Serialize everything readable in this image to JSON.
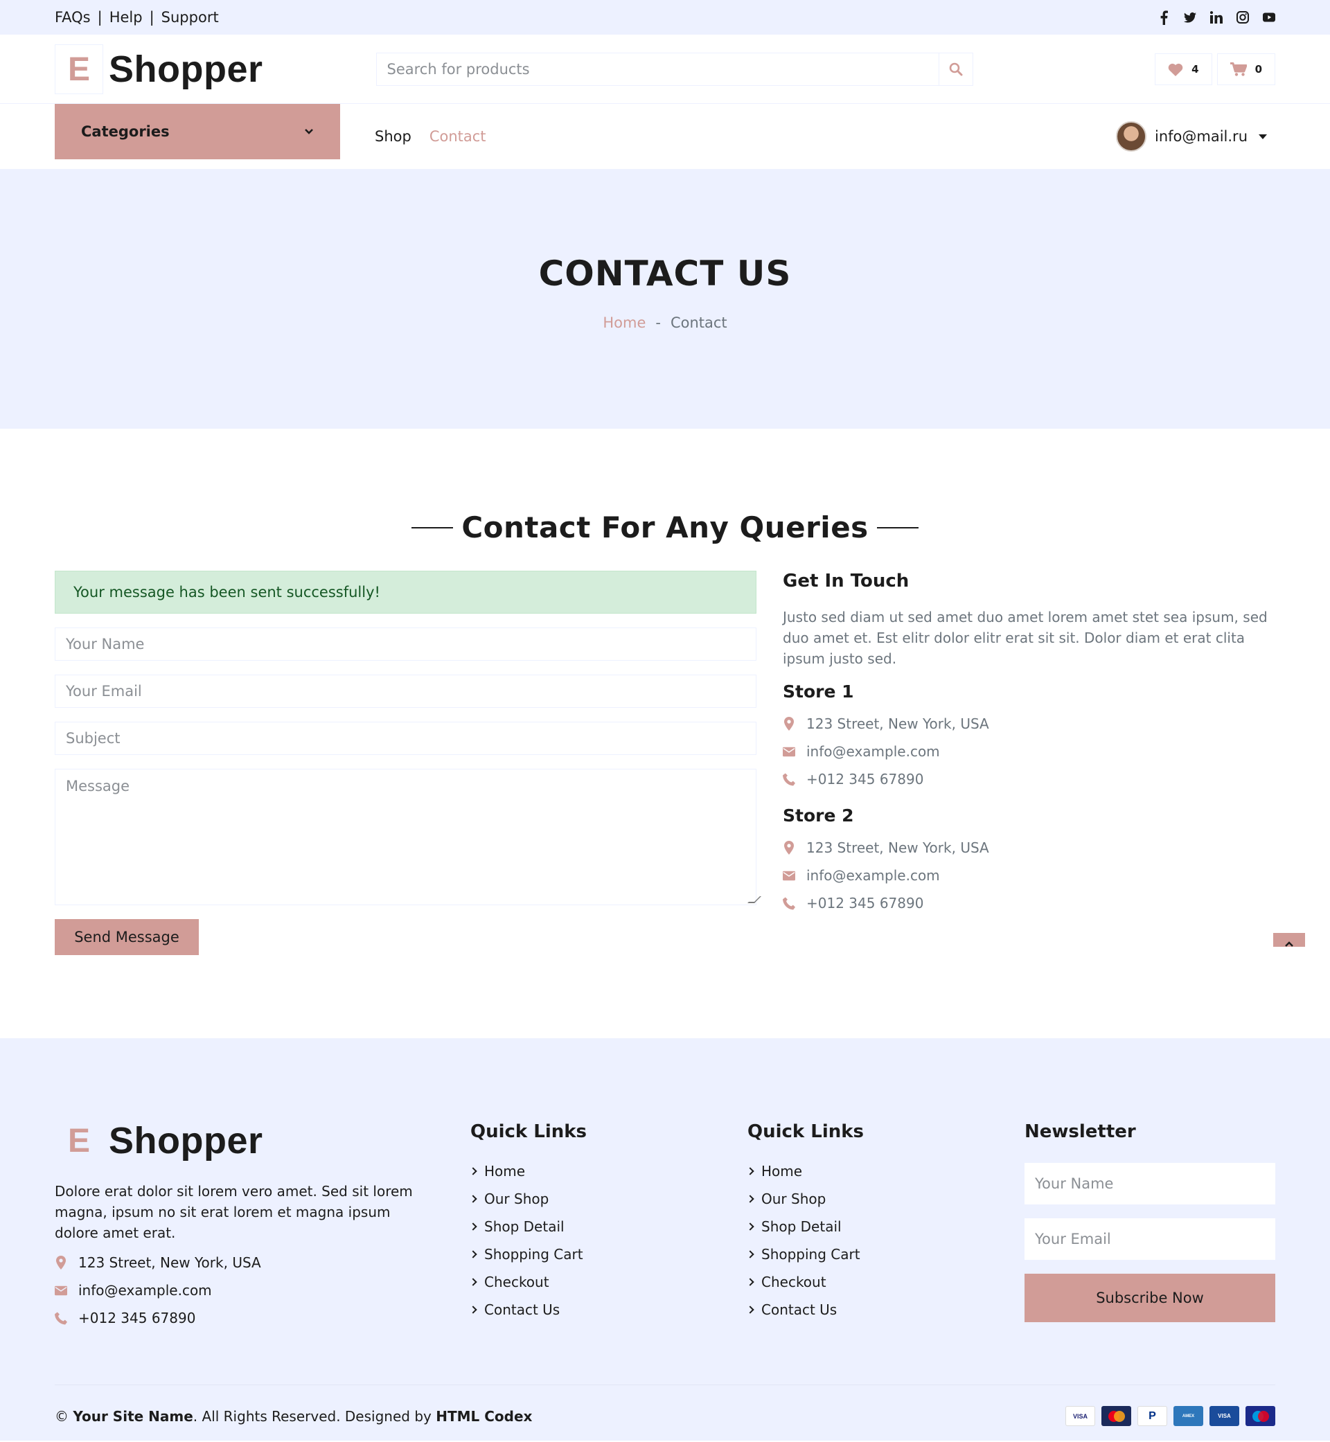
{
  "topbar": {
    "links": [
      "FAQs",
      "Help",
      "Support"
    ],
    "separator": "|"
  },
  "socials": [
    "facebook-icon",
    "twitter-icon",
    "linkedin-icon",
    "instagram-icon",
    "youtube-icon"
  ],
  "brand": {
    "letter": "E",
    "name": "Shopper"
  },
  "search": {
    "placeholder": "Search for products"
  },
  "header": {
    "wishlist_count": "4",
    "cart_count": "0"
  },
  "nav": {
    "categories_label": "Categories",
    "links": [
      "Shop",
      "Contact"
    ],
    "user_email": "info@mail.ru"
  },
  "page_header": {
    "title": "CONTACT US",
    "breadcrumb_home": "Home",
    "breadcrumb_sep": "-",
    "breadcrumb_current": "Contact"
  },
  "contact": {
    "section_title": "Contact For Any Queries",
    "alert": "Your message has been sent successfully!",
    "placeholders": {
      "name": "Your Name",
      "email": "Your Email",
      "subject": "Subject",
      "message": "Message"
    },
    "send_label": "Send Message",
    "get_in_touch": "Get In Touch",
    "description": "Justo sed diam ut sed amet duo amet lorem amet stet sea ipsum, sed duo amet et. Est elitr dolor elitr erat sit sit. Dolor diam et erat clita ipsum justo sed.",
    "stores": [
      {
        "name": "Store 1",
        "address": "123 Street, New York, USA",
        "email": "info@example.com",
        "phone": "+012 345 67890"
      },
      {
        "name": "Store 2",
        "address": "123 Street, New York, USA",
        "email": "info@example.com",
        "phone": "+012 345 67890"
      }
    ]
  },
  "footer": {
    "about": "Dolore erat dolor sit lorem vero amet. Sed sit lorem magna, ipsum no sit erat lorem et magna ipsum dolore amet erat.",
    "address": "123 Street, New York, USA",
    "email": "info@example.com",
    "phone": "+012 345 67890",
    "columns": [
      {
        "title": "Quick Links",
        "links": [
          "Home",
          "Our Shop",
          "Shop Detail",
          "Shopping Cart",
          "Checkout",
          "Contact Us"
        ]
      },
      {
        "title": "Quick Links",
        "links": [
          "Home",
          "Our Shop",
          "Shop Detail",
          "Shopping Cart",
          "Checkout",
          "Contact Us"
        ]
      }
    ],
    "newsletter": {
      "title": "Newsletter",
      "name_placeholder": "Your Name",
      "email_placeholder": "Your Email",
      "button": "Subscribe Now"
    },
    "copyright": {
      "symbol": "©",
      "site": "Your Site Name",
      "text": ". All Rights Reserved. Designed by ",
      "designer": "HTML Codex"
    },
    "payments": [
      "VISA",
      "MasterCard",
      "PayPal",
      "AMERICAN EXPRESS",
      "VISA Electron",
      "Maestro"
    ]
  },
  "colors": {
    "accent": "#d19c97",
    "light": "#edf1ff",
    "dark": "#1c1c1c",
    "success_bg": "#d4edda"
  }
}
